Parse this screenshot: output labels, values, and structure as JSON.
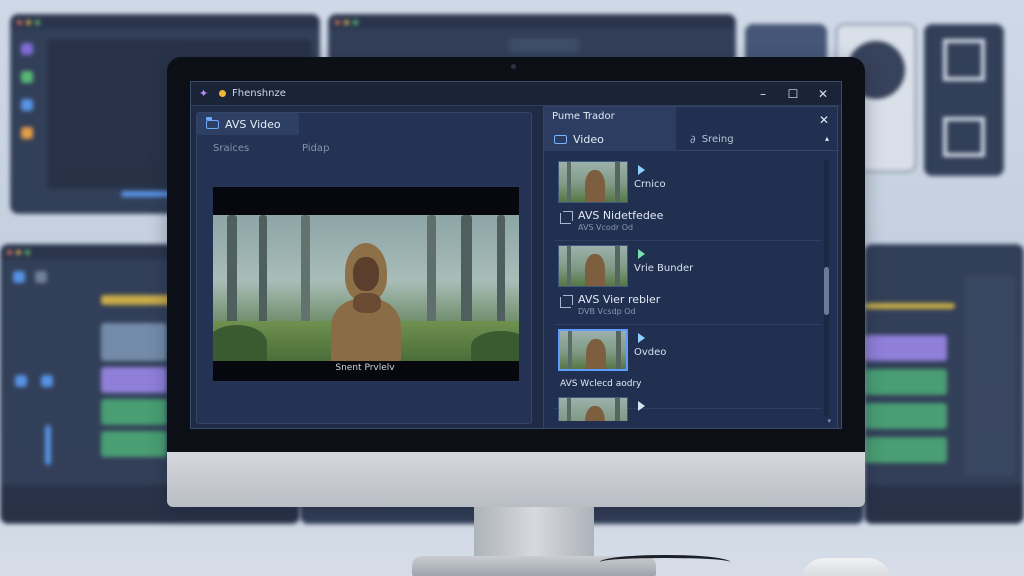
{
  "window": {
    "title": "Fhenshnze",
    "controls": {
      "minimize": "–",
      "maximize": "☐",
      "close": "✕"
    }
  },
  "left_panel": {
    "tab_label": "AVS Video",
    "subtabs": [
      "Sraices",
      "Pidap"
    ],
    "preview_caption": "Snent Prvlelv"
  },
  "right_panel": {
    "header": "Pume Trador",
    "close": "✕",
    "collapse": "▴",
    "tabs": [
      {
        "label": "Video",
        "icon": "video-icon"
      },
      {
        "label": "Sreing",
        "icon": "link-icon"
      }
    ],
    "items": [
      {
        "label": "Crnico",
        "title": "AVS Nidetfedee",
        "meta": "AVS Vcodr Od",
        "selected": false
      },
      {
        "label": "Vrie Bunder",
        "title": "AVS Vier rebler",
        "meta": "DVB Vcsdp Od",
        "selected": false
      },
      {
        "label": "Ovdeo",
        "title": "AVS Wclecd aodry",
        "meta": "",
        "selected": true
      },
      {
        "label": "",
        "title": "",
        "meta": "",
        "selected": false
      }
    ]
  },
  "colors": {
    "accent": "#5f9bff",
    "app_background": "#1f2b44",
    "panel": "#243353",
    "title_dot": "#f2b833"
  }
}
